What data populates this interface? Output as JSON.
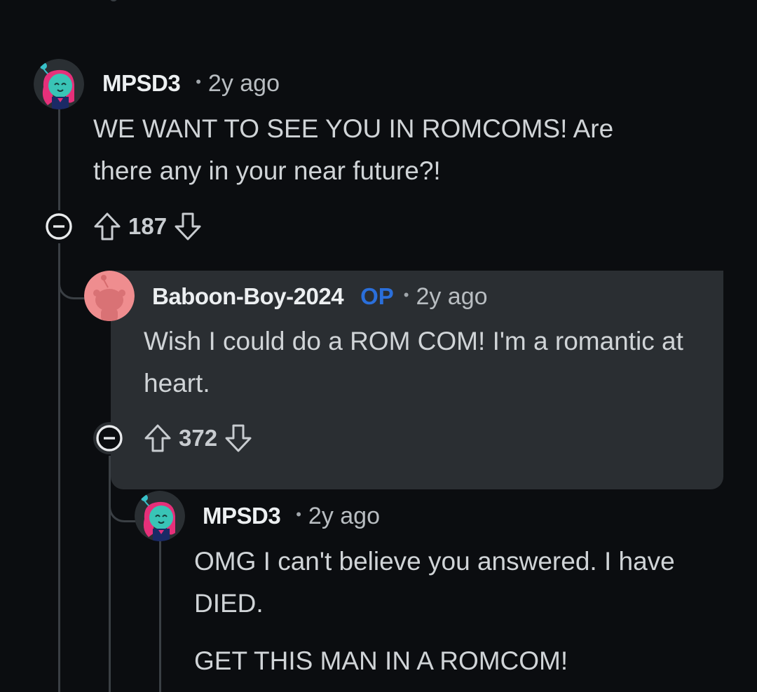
{
  "comments": [
    {
      "username": "MPSD3",
      "op_badge": "",
      "separator": "•",
      "time": "2y ago",
      "body": [
        "WE WANT TO SEE YOU IN ROMCOMS! Are there any in your near future?!"
      ],
      "votes": "187",
      "avatar": "snoo-avatar-pink-hair"
    },
    {
      "username": "Baboon-Boy-2024",
      "op_badge": "OP",
      "separator": "•",
      "time": "2y ago",
      "body": [
        "Wish I could do a ROM COM! I'm a romantic at heart."
      ],
      "votes": "372",
      "avatar": "default-snoo-avatar"
    },
    {
      "username": "MPSD3",
      "op_badge": "",
      "separator": "•",
      "time": "2y ago",
      "body": [
        "OMG I can't believe you answered. I have DIED.",
        "GET THIS MAN IN A ROMCOM!"
      ],
      "avatar": "snoo-avatar-pink-hair"
    }
  ],
  "icons": {
    "collapse": "minus-circle-icon",
    "upvote": "arrow-up-outline-icon",
    "downvote": "arrow-down-outline-icon"
  },
  "colors": {
    "background": "#0b0d10",
    "highlight": "#2a2e32",
    "op_badge": "#2a6fdb",
    "thread_line": "#3a3f44"
  }
}
